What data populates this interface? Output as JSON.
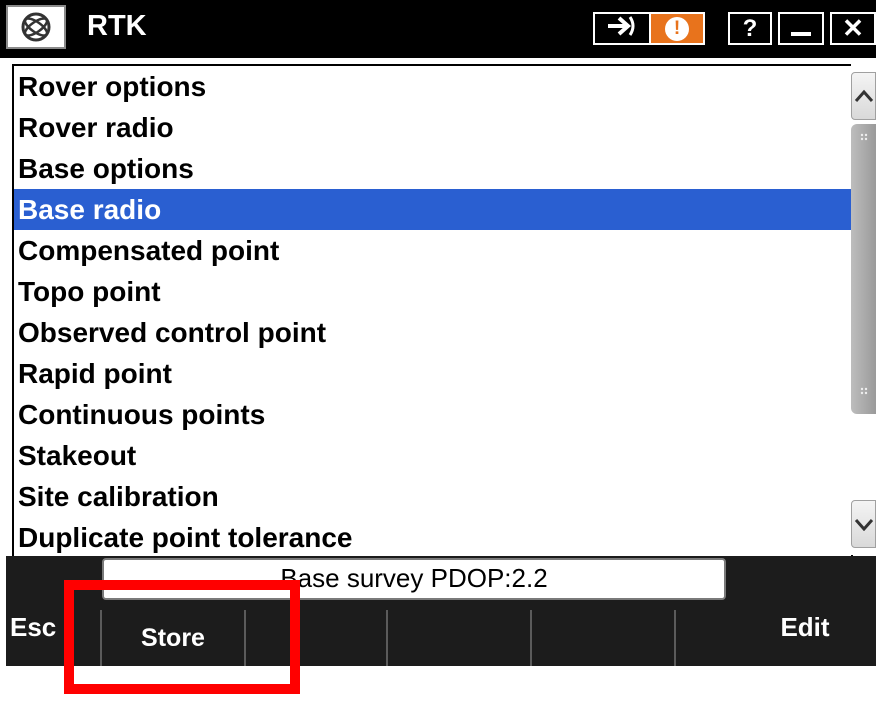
{
  "titlebar": {
    "title": "RTK",
    "icons": {
      "app": "trimble-globe-icon",
      "connect": "connect-arrow-icon",
      "alert": "alert-exclamation-icon",
      "help": "help-icon",
      "minimize": "minimize-icon",
      "close": "close-icon"
    },
    "help_label": "?",
    "close_label": "✕",
    "alert_label": "!"
  },
  "list": {
    "items": [
      {
        "label": "Rover options",
        "selected": false
      },
      {
        "label": "Rover radio",
        "selected": false
      },
      {
        "label": "Base options",
        "selected": false
      },
      {
        "label": "Base radio",
        "selected": true
      },
      {
        "label": "Compensated point",
        "selected": false
      },
      {
        "label": "Topo point",
        "selected": false
      },
      {
        "label": "Observed control point",
        "selected": false
      },
      {
        "label": "Rapid point",
        "selected": false
      },
      {
        "label": "Continuous points",
        "selected": false
      },
      {
        "label": "Stakeout",
        "selected": false
      },
      {
        "label": "Site calibration",
        "selected": false
      },
      {
        "label": "Duplicate point tolerance",
        "selected": false
      }
    ]
  },
  "status": {
    "text": "Base survey  PDOP:2.2"
  },
  "softkeys": {
    "esc": "Esc",
    "edit": "Edit",
    "row": [
      "Store",
      "",
      "",
      "",
      ""
    ]
  },
  "colors": {
    "selection": "#2a5fd1",
    "alert": "#e8731c",
    "highlight": "#ff0000"
  }
}
